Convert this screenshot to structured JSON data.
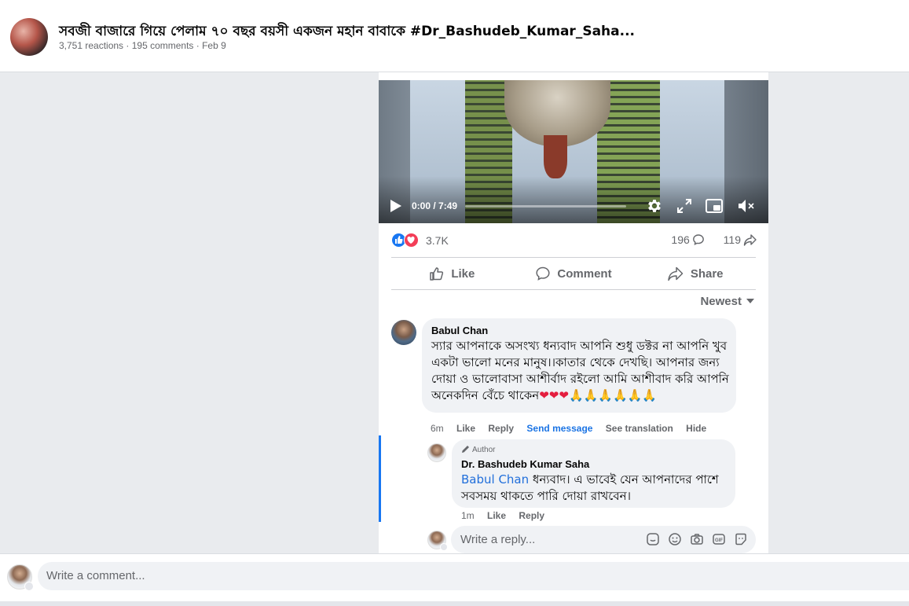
{
  "post": {
    "title": "সবজী বাজারে গিয়ে পেলাম ৭০ বছর বয়সী একজন মহান বাবাকে #Dr_Bashudeb_Kumar_Saha...",
    "meta": "3,751 reactions · 195 comments · Feb 9"
  },
  "video": {
    "time": "0:00 / 7:49",
    "progress": 0
  },
  "stats": {
    "reactions": "3.7K",
    "comments": "196",
    "shares": "119"
  },
  "actions": {
    "like": "Like",
    "comment": "Comment",
    "share": "Share"
  },
  "sort": {
    "label": "Newest"
  },
  "comments": [
    {
      "name": "Babul Chan",
      "text": "স্যার আপনাকে অসংখ্য ধন্যবাদ আপনি শুধু ডক্টর না আপনি খুব একটা ভালো মনের মানুষ।।কাতার থেকে দেখছি। আপনার জন্য দোয়া ও ভালোবাসা আশীর্বাদ রইলো আমি আশীবাদ করি আপনি অনেকদিন বেঁচে থাকেন",
      "emoji_hearts": "❤❤❤",
      "emoji_tail": "🙏🙏🙏🙏🙏🙏",
      "time": "6m",
      "like": "Like",
      "reply": "Reply",
      "send_message": "Send message",
      "see_translation": "See translation",
      "hide": "Hide"
    },
    {
      "badge": "Author",
      "name": "Dr. Bashudeb Kumar Saha",
      "mention": "Babul Chan",
      "text": " ধন্যবাদ। এ ভাবেই যেন আপনাদের পাশে সবসময় থাকতে পারি দোয়া রাখবেন।",
      "time": "1m",
      "like": "Like",
      "reply": "Reply"
    }
  ],
  "reply_box": {
    "placeholder": "Write a reply..."
  },
  "comment_box": {
    "placeholder": "Write a comment..."
  },
  "colors": {
    "link": "#1b74e4",
    "like_blue": "#1877f2",
    "love_red": "#f33e58"
  },
  "icons": [
    "play-icon",
    "settings-gear-icon",
    "fullscreen-icon",
    "pip-icon",
    "mute-icon",
    "like-reaction-icon",
    "love-reaction-icon",
    "comment-icon",
    "share-icon",
    "thumbs-up-icon",
    "pencil-icon",
    "sticker-icon",
    "emoji-icon",
    "camera-icon",
    "gif-icon",
    "avatar-sticker-icon"
  ]
}
